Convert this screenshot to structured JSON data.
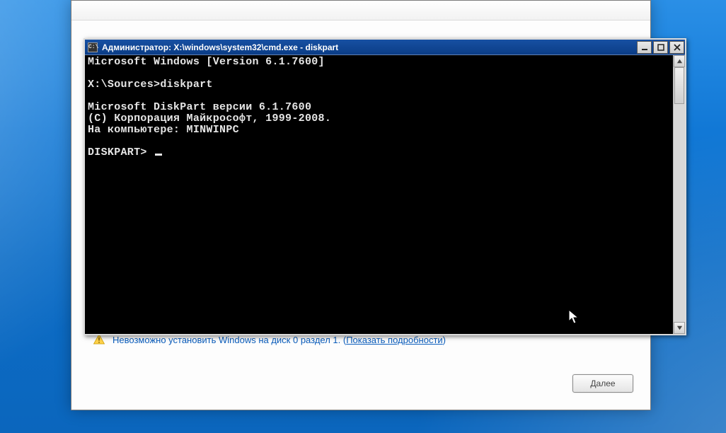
{
  "installer": {
    "warning_prefix": "Невозможно установить Windows на диск 0 раздел 1. (",
    "warning_link": "Показать подробности",
    "warning_suffix": ")",
    "next_button_label": "Далее",
    "next_button_underline_char": "Д"
  },
  "cmd": {
    "title": "Администратор: X:\\windows\\system32\\cmd.exe - diskpart",
    "icon_glyph": "C:\\",
    "lines": {
      "l0": "Microsoft Windows [Version 6.1.7600]",
      "l1": "",
      "l2": "X:\\Sources>diskpart",
      "l3": "",
      "l4": "Microsoft DiskPart версии 6.1.7600",
      "l5": "(C) Корпорация Майкрософт, 1999-2008.",
      "l6": "На компьютере: MINWINPC",
      "l7": "",
      "l8_prompt": "DISKPART> "
    }
  }
}
